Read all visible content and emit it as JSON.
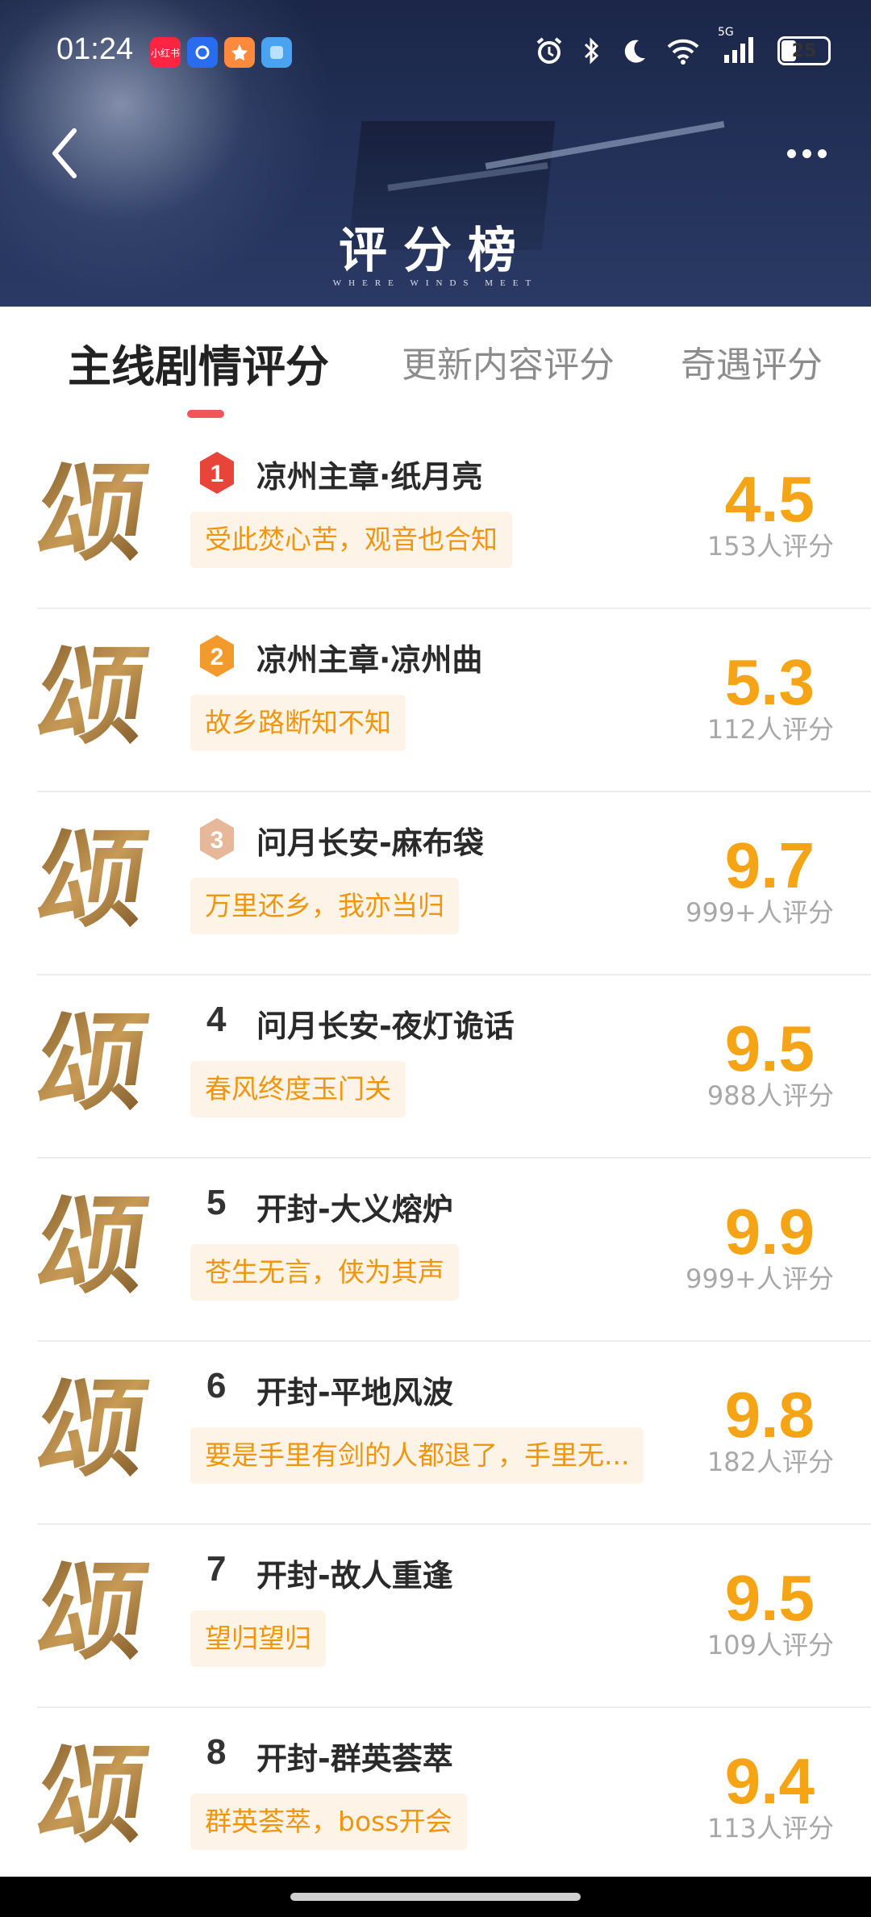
{
  "status_bar": {
    "time": "01:24",
    "apps": [
      {
        "icon": "xiaohongshu-app-icon",
        "label": "小红书",
        "color": "#ff2442"
      },
      {
        "icon": "circle-app-icon",
        "label": "",
        "color": "#2a6cf0"
      },
      {
        "icon": "star-app-icon",
        "label": "",
        "color": "#ff8a3d"
      },
      {
        "icon": "wallpaper-app-icon",
        "label": "",
        "color": "#4aa3f0"
      }
    ],
    "network": "5G",
    "battery": "25"
  },
  "header": {
    "title": "评分榜",
    "subtitle": "WHERE WINDS MEET"
  },
  "tabs": [
    {
      "label": "主线剧情评分",
      "active": true
    },
    {
      "label": "更新内容评分",
      "active": false
    },
    {
      "label": "奇遇评分",
      "active": false
    }
  ],
  "list": [
    {
      "rank": "1",
      "title": "凉州主章·纸月亮",
      "quote": "受此焚心苦，观音也合知",
      "score": "4.5",
      "count": "153人评分"
    },
    {
      "rank": "2",
      "title": "凉州主章·凉州曲",
      "quote": "故乡路断知不知",
      "score": "5.3",
      "count": "112人评分"
    },
    {
      "rank": "3",
      "title": "问月长安-麻布袋",
      "quote": "万里还乡，我亦当归",
      "score": "9.7",
      "count": "999+人评分"
    },
    {
      "rank": "4",
      "title": "问月长安-夜灯诡话",
      "quote": "春风终度玉门关",
      "score": "9.5",
      "count": "988人评分"
    },
    {
      "rank": "5",
      "title": "开封-大义熔炉",
      "quote": "苍生无言，侠为其声",
      "score": "9.9",
      "count": "999+人评分"
    },
    {
      "rank": "6",
      "title": "开封-平地风波",
      "quote": "要是手里有剑的人都退了，手里无...",
      "score": "9.8",
      "count": "182人评分"
    },
    {
      "rank": "7",
      "title": "开封-故人重逢",
      "quote": "望归望归",
      "score": "9.5",
      "count": "109人评分"
    },
    {
      "rank": "8",
      "title": "开封-群英荟萃",
      "quote": "群英荟萃，boss开会",
      "score": "9.4",
      "count": "113人评分"
    }
  ],
  "icon_glyph": "颂",
  "colors": {
    "accent": "#f5a416",
    "quote_bg": "#fdf3e6",
    "tab_indicator": "#f0555a",
    "rank1": "#e8443a",
    "rank2": "#f39a2c",
    "rank3": "#e7b79a"
  }
}
